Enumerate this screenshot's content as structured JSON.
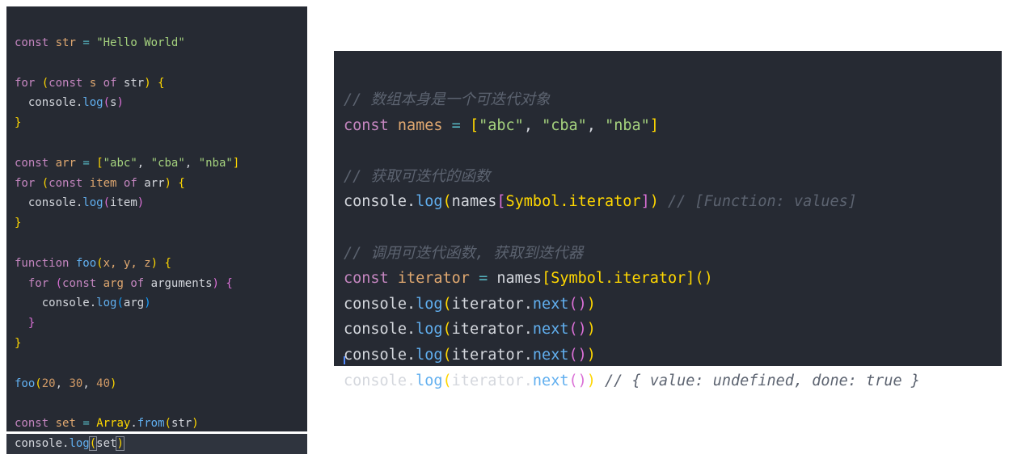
{
  "left_editor": {
    "lines": [
      [
        {
          "t": "const",
          "c": "kw"
        },
        {
          "t": " "
        },
        {
          "t": "str",
          "c": "var"
        },
        {
          "t": " = ",
          "c": "op"
        },
        {
          "t": "\"Hello World\"",
          "c": "str"
        }
      ],
      [],
      [
        {
          "t": "for",
          "c": "kw"
        },
        {
          "t": " "
        },
        {
          "t": "(",
          "c": "b1"
        },
        {
          "t": "const",
          "c": "kw"
        },
        {
          "t": " "
        },
        {
          "t": "s",
          "c": "var"
        },
        {
          "t": " "
        },
        {
          "t": "of",
          "c": "kw"
        },
        {
          "t": " str",
          "c": "pl"
        },
        {
          "t": ")",
          "c": "b1"
        },
        {
          "t": " "
        },
        {
          "t": "{",
          "c": "b1"
        }
      ],
      [
        {
          "t": "  console.",
          "c": "pl"
        },
        {
          "t": "log",
          "c": "fn"
        },
        {
          "t": "(",
          "c": "b2"
        },
        {
          "t": "s",
          "c": "pl"
        },
        {
          "t": ")",
          "c": "b2"
        }
      ],
      [
        {
          "t": "}",
          "c": "b1"
        }
      ],
      [],
      [
        {
          "t": "const",
          "c": "kw"
        },
        {
          "t": " "
        },
        {
          "t": "arr",
          "c": "var"
        },
        {
          "t": " = ",
          "c": "op"
        },
        {
          "t": "[",
          "c": "b1"
        },
        {
          "t": "\"abc\"",
          "c": "str"
        },
        {
          "t": ", ",
          "c": "pl"
        },
        {
          "t": "\"cba\"",
          "c": "str"
        },
        {
          "t": ", ",
          "c": "pl"
        },
        {
          "t": "\"nba\"",
          "c": "str"
        },
        {
          "t": "]",
          "c": "b1"
        }
      ],
      [
        {
          "t": "for",
          "c": "kw"
        },
        {
          "t": " "
        },
        {
          "t": "(",
          "c": "b1"
        },
        {
          "t": "const",
          "c": "kw"
        },
        {
          "t": " "
        },
        {
          "t": "item",
          "c": "var"
        },
        {
          "t": " "
        },
        {
          "t": "of",
          "c": "kw"
        },
        {
          "t": " arr",
          "c": "pl"
        },
        {
          "t": ")",
          "c": "b1"
        },
        {
          "t": " "
        },
        {
          "t": "{",
          "c": "b1"
        }
      ],
      [
        {
          "t": "  console.",
          "c": "pl"
        },
        {
          "t": "log",
          "c": "fn"
        },
        {
          "t": "(",
          "c": "b2"
        },
        {
          "t": "item",
          "c": "pl"
        },
        {
          "t": ")",
          "c": "b2"
        }
      ],
      [
        {
          "t": "}",
          "c": "b1"
        }
      ],
      [],
      [
        {
          "t": "function",
          "c": "kw"
        },
        {
          "t": " "
        },
        {
          "t": "foo",
          "c": "fn"
        },
        {
          "t": "(",
          "c": "b1"
        },
        {
          "t": "x, y, z",
          "c": "var"
        },
        {
          "t": ")",
          "c": "b1"
        },
        {
          "t": " "
        },
        {
          "t": "{",
          "c": "b1"
        }
      ],
      [
        {
          "t": "  "
        },
        {
          "t": "for",
          "c": "kw"
        },
        {
          "t": " "
        },
        {
          "t": "(",
          "c": "b2"
        },
        {
          "t": "const",
          "c": "kw"
        },
        {
          "t": " "
        },
        {
          "t": "arg",
          "c": "var"
        },
        {
          "t": " "
        },
        {
          "t": "of",
          "c": "kw"
        },
        {
          "t": " arguments",
          "c": "pl"
        },
        {
          "t": ")",
          "c": "b2"
        },
        {
          "t": " "
        },
        {
          "t": "{",
          "c": "b2"
        }
      ],
      [
        {
          "t": "    console.",
          "c": "pl"
        },
        {
          "t": "log",
          "c": "fn"
        },
        {
          "t": "(",
          "c": "b3"
        },
        {
          "t": "arg",
          "c": "pl"
        },
        {
          "t": ")",
          "c": "b3"
        }
      ],
      [
        {
          "t": "  "
        },
        {
          "t": "}",
          "c": "b2"
        }
      ],
      [
        {
          "t": "}",
          "c": "b1"
        }
      ],
      [],
      [
        {
          "t": "foo",
          "c": "fn"
        },
        {
          "t": "(",
          "c": "b1"
        },
        {
          "t": "20",
          "c": "num"
        },
        {
          "t": ", ",
          "c": "pl"
        },
        {
          "t": "30",
          "c": "num"
        },
        {
          "t": ", ",
          "c": "pl"
        },
        {
          "t": "40",
          "c": "num"
        },
        {
          "t": ")",
          "c": "b1"
        }
      ],
      [],
      [
        {
          "t": "const",
          "c": "kw"
        },
        {
          "t": " "
        },
        {
          "t": "set",
          "c": "var"
        },
        {
          "t": " = ",
          "c": "op"
        },
        {
          "t": "Array",
          "c": "b1"
        },
        {
          "t": ".",
          "c": "pl"
        },
        {
          "t": "from",
          "c": "fn"
        },
        {
          "t": "(",
          "c": "b1"
        },
        {
          "t": "str",
          "c": "pl"
        },
        {
          "t": ")",
          "c": "b1"
        }
      ],
      [
        {
          "t": "console.",
          "c": "pl"
        },
        {
          "t": "log",
          "c": "fn"
        },
        {
          "t": "(",
          "c": "b1 match"
        },
        {
          "t": "set",
          "c": "pl"
        },
        {
          "t": ")",
          "c": "b1 match"
        }
      ]
    ]
  },
  "right_editor": {
    "lines": [
      [
        {
          "t": "// 数组本身是一个可迭代对象",
          "c": "cm"
        }
      ],
      [
        {
          "t": "const",
          "c": "kw"
        },
        {
          "t": " "
        },
        {
          "t": "names",
          "c": "var"
        },
        {
          "t": " = ",
          "c": "op"
        },
        {
          "t": "[",
          "c": "b1"
        },
        {
          "t": "\"abc\"",
          "c": "str"
        },
        {
          "t": ", ",
          "c": "pl"
        },
        {
          "t": "\"cba\"",
          "c": "str"
        },
        {
          "t": ", ",
          "c": "pl"
        },
        {
          "t": "\"nba\"",
          "c": "str"
        },
        {
          "t": "]",
          "c": "b1"
        }
      ],
      [],
      [
        {
          "t": "// 获取可迭代的函数",
          "c": "cm"
        }
      ],
      [
        {
          "t": "console.",
          "c": "pl"
        },
        {
          "t": "log",
          "c": "fn"
        },
        {
          "t": "(",
          "c": "b1"
        },
        {
          "t": "names",
          "c": "pl"
        },
        {
          "t": "[",
          "c": "b2"
        },
        {
          "t": "Symbol.iterator",
          "c": "b1"
        },
        {
          "t": "]",
          "c": "b2"
        },
        {
          "t": ")",
          "c": "b1"
        },
        {
          "t": " "
        },
        {
          "t": "// [Function: values]",
          "c": "cm"
        }
      ],
      [],
      [
        {
          "t": "// 调用可迭代函数, 获取到迭代器",
          "c": "cm"
        }
      ],
      [
        {
          "t": "const",
          "c": "kw"
        },
        {
          "t": " "
        },
        {
          "t": "iterator",
          "c": "var"
        },
        {
          "t": " = ",
          "c": "op"
        },
        {
          "t": "names",
          "c": "pl"
        },
        {
          "t": "[",
          "c": "b1"
        },
        {
          "t": "Symbol.iterator",
          "c": "b1"
        },
        {
          "t": "]",
          "c": "b1"
        },
        {
          "t": "()",
          "c": "b1"
        }
      ],
      [
        {
          "t": "console.",
          "c": "pl"
        },
        {
          "t": "log",
          "c": "fn"
        },
        {
          "t": "(",
          "c": "b1"
        },
        {
          "t": "iterator.",
          "c": "pl"
        },
        {
          "t": "next",
          "c": "fn"
        },
        {
          "t": "()",
          "c": "b2"
        },
        {
          "t": ")",
          "c": "b1"
        }
      ],
      [
        {
          "t": "console.",
          "c": "pl"
        },
        {
          "t": "log",
          "c": "fn"
        },
        {
          "t": "(",
          "c": "b1"
        },
        {
          "t": "iterator.",
          "c": "pl"
        },
        {
          "t": "next",
          "c": "fn"
        },
        {
          "t": "()",
          "c": "b2"
        },
        {
          "t": ")",
          "c": "b1"
        }
      ],
      [
        {
          "t": "console.",
          "c": "pl"
        },
        {
          "t": "log",
          "c": "fn"
        },
        {
          "t": "(",
          "c": "b1"
        },
        {
          "t": "iterator.",
          "c": "pl"
        },
        {
          "t": "next",
          "c": "fn"
        },
        {
          "t": "()",
          "c": "b2"
        },
        {
          "t": ")",
          "c": "b1"
        }
      ],
      [
        {
          "t": "console.",
          "c": "pl"
        },
        {
          "t": "log",
          "c": "fn"
        },
        {
          "t": "(",
          "c": "b1"
        },
        {
          "t": "iterator.",
          "c": "pl"
        },
        {
          "t": "next",
          "c": "fn"
        },
        {
          "t": "()",
          "c": "b2"
        },
        {
          "t": ")",
          "c": "b1"
        },
        {
          "t": " "
        },
        {
          "t": "// { value: undefined, done: true }",
          "c": "cm"
        }
      ]
    ]
  }
}
